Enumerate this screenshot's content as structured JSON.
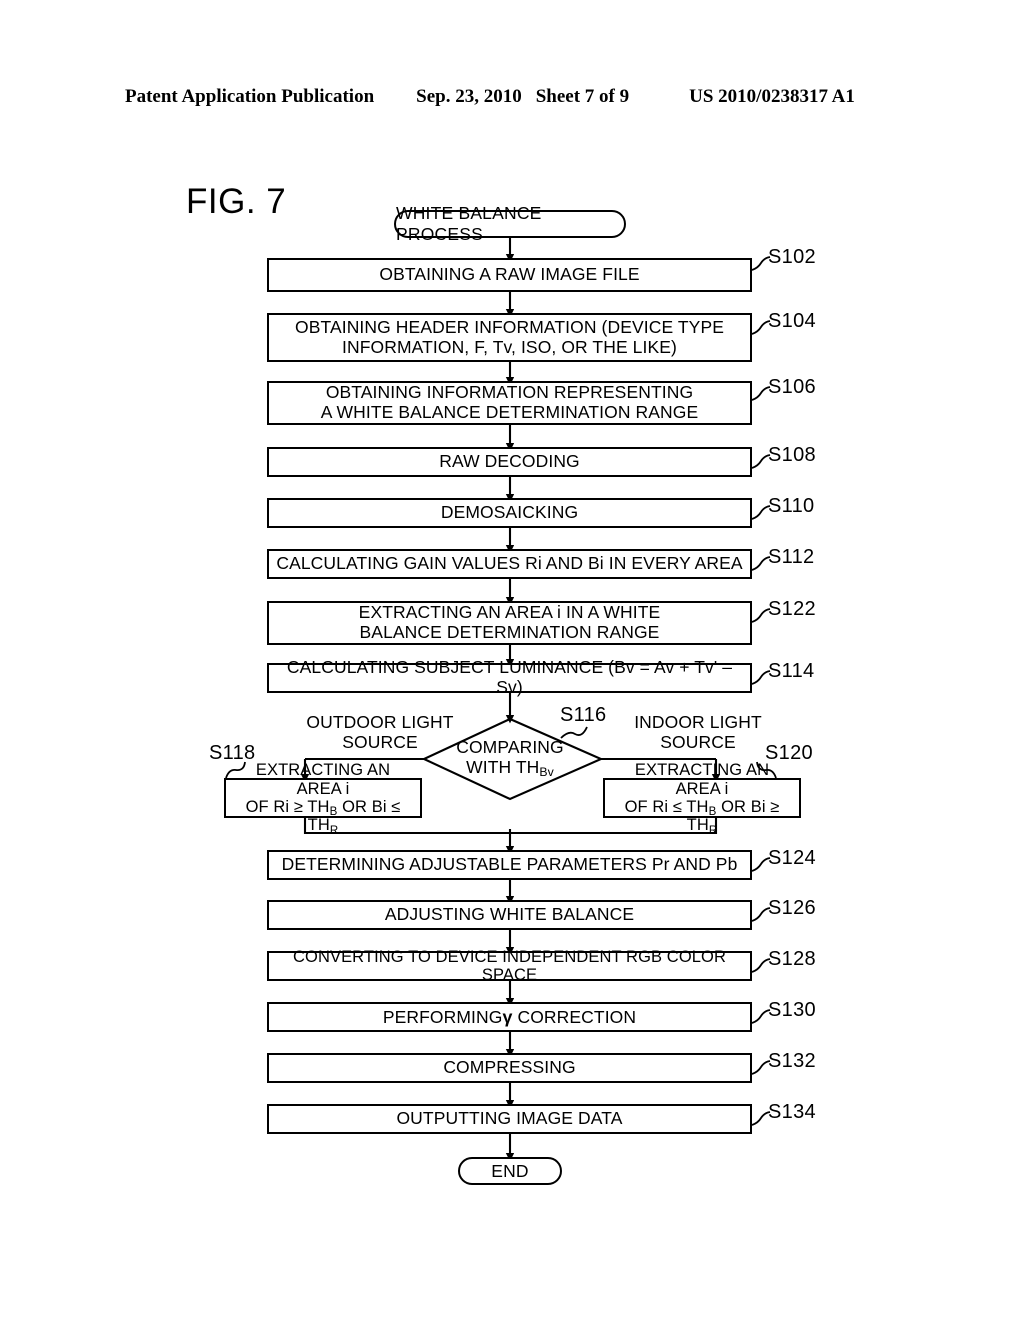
{
  "header": {
    "left": "Patent Application Publication",
    "date": "Sep. 23, 2010",
    "sheet": "Sheet 7 of 9",
    "patent_number": "US 2010/0238317 A1"
  },
  "figure": {
    "title": "FIG. 7"
  },
  "flowchart": {
    "start_label": "WHITE BALANCE PROCESS",
    "end_label": "END",
    "steps": [
      {
        "id": "S102",
        "text": "OBTAINING A RAW IMAGE FILE"
      },
      {
        "id": "S104",
        "line1": "OBTAINING HEADER INFORMATION (DEVICE TYPE",
        "line2": "INFORMATION, F, Tv, ISO, OR THE LIKE)"
      },
      {
        "id": "S106",
        "line1": "OBTAINING INFORMATION REPRESENTING",
        "line2": "A WHITE BALANCE DETERMINATION RANGE"
      },
      {
        "id": "S108",
        "text": "RAW DECODING"
      },
      {
        "id": "S110",
        "text": "DEMOSAICKING"
      },
      {
        "id": "S112",
        "text": "CALCULATING GAIN VALUES Ri AND Bi IN EVERY AREA"
      },
      {
        "id": "S122",
        "line1": "EXTRACTING AN AREA i IN A WHITE",
        "line2": "BALANCE DETERMINATION RANGE"
      },
      {
        "id": "S114",
        "text": "CALCULATING SUBJECT LUMINANCE (Bv = Av + Tv' – Sv)"
      },
      {
        "id": "S124",
        "text": "DETERMINING ADJUSTABLE PARAMETERS Pr AND Pb"
      },
      {
        "id": "S126",
        "text": "ADJUSTING WHITE BALANCE"
      },
      {
        "id": "S128",
        "text": "CONVERTING TO DEVICE INDEPENDENT RGB COLOR SPACE"
      },
      {
        "id": "S130",
        "text_before_gamma": "PERFORMING",
        "gamma": "γ",
        "text_after_gamma": " CORRECTION"
      },
      {
        "id": "S132",
        "text": "COMPRESSING"
      },
      {
        "id": "S134",
        "text": "OUTPUTTING IMAGE DATA"
      }
    ],
    "decision": {
      "id": "S116",
      "line1": "COMPARING",
      "line2_prefix": "WITH TH",
      "line2_sub": "Bv"
    },
    "branches": {
      "left_caption_line1": "OUTDOOR LIGHT",
      "left_caption_line2": "SOURCE",
      "right_caption_line1": "INDOOR LIGHT",
      "right_caption_line2": "SOURCE"
    },
    "branch_boxes": [
      {
        "id": "S118",
        "line1": "EXTRACTING AN AREA i",
        "line2_a": "OF Ri ",
        "line2_op1": "≥",
        "line2_b": " TH",
        "line2_sub1": "B",
        "line2_c": " OR Bi ",
        "line2_op2": "≤",
        "line2_d": " TH",
        "line2_sub2": "R"
      },
      {
        "id": "S120",
        "line1": "EXTRACTING AN AREA i",
        "line2_a": "OF Ri ",
        "line2_op1": "≤",
        "line2_b": " TH",
        "line2_sub1": "B",
        "line2_c": " OR Bi ",
        "line2_op2": "≥",
        "line2_d": " TH",
        "line2_sub2": "R"
      }
    ]
  },
  "colors": {
    "ink": "#000000",
    "paper": "#ffffff"
  }
}
